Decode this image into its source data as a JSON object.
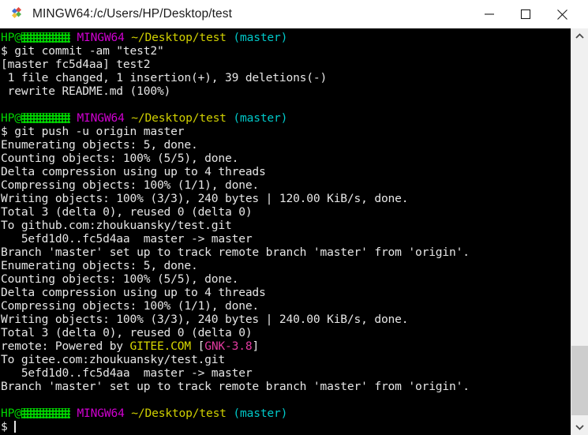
{
  "window": {
    "title": "MINGW64:/c/Users/HP/Desktop/test",
    "icon": "mingw-diamond-icon",
    "minimize_label": "—",
    "maximize_label": "☐",
    "close_label": "✕"
  },
  "colors": {
    "background": "#000000",
    "foreground": "#e6e6e6",
    "green": "#00d400",
    "magenta": "#d000d0",
    "yellow": "#d0d000",
    "cyan": "#00c8c8",
    "pink": "#e23ba0",
    "titlebar_bg": "#ffffff",
    "scrollbar_bg": "#f0f0f0",
    "scrollbar_thumb": "#cdcdcd"
  },
  "prompt": {
    "user": "HP@",
    "host": "[redacted]",
    "shell": "MINGW64",
    "path": "~/Desktop/test",
    "branch": "(master)",
    "sigil": "$"
  },
  "terminal": {
    "commands": [
      "git commit -am \"test2\"",
      "git push -u origin master"
    ],
    "lines": [
      "[master fc5d4aa] test2",
      " 1 file changed, 1 insertion(+), 39 deletions(-)",
      " rewrite README.md (100%)",
      "Enumerating objects: 5, done.",
      "Counting objects: 100% (5/5), done.",
      "Delta compression using up to 4 threads",
      "Compressing objects: 100% (1/1), done.",
      "Writing objects: 100% (3/3), 240 bytes | 120.00 KiB/s, done.",
      "Total 3 (delta 0), reused 0 (delta 0)",
      "To github.com:zhoukuansky/test.git",
      "   5efd1d0..fc5d4aa  master -> master",
      "Branch 'master' set up to track remote branch 'master' from 'origin'.",
      "Enumerating objects: 5, done.",
      "Counting objects: 100% (5/5), done.",
      "Delta compression using up to 4 threads",
      "Compressing objects: 100% (1/1), done.",
      "Writing objects: 100% (3/3), 240 bytes | 240.00 KiB/s, done.",
      "Total 3 (delta 0), reused 0 (delta 0)"
    ],
    "remote_line": {
      "prefix": "remote: Powered by ",
      "brand": "GITEE.COM",
      "bracket_open": " [",
      "version": "GNK-3.8",
      "bracket_close": "]"
    },
    "tail_lines": [
      "To gitee.com:zhoukuansky/test.git",
      "   5efd1d0..fc5d4aa  master -> master",
      "Branch 'master' set up to track remote branch 'master' from 'origin'."
    ]
  },
  "scrollbar": {
    "up_arrow": "∧",
    "down_arrow": "∨"
  }
}
